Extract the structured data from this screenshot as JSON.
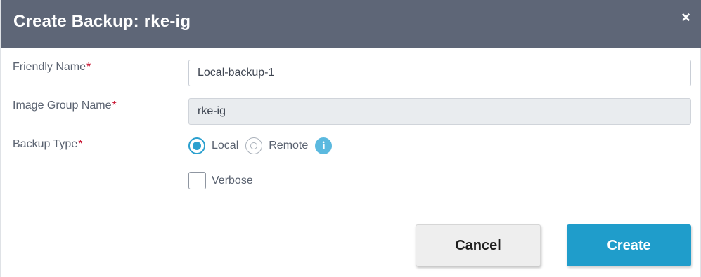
{
  "dialog": {
    "title": "Create Backup: rke-ig",
    "close_icon": "×"
  },
  "form": {
    "friendly_name": {
      "label": "Friendly Name",
      "required_mark": "*",
      "value": "Local-backup-1"
    },
    "image_group_name": {
      "label": "Image Group Name",
      "required_mark": "*",
      "value": "rke-ig"
    },
    "backup_type": {
      "label": "Backup Type",
      "required_mark": "*",
      "options": [
        {
          "label": "Local",
          "selected": true
        },
        {
          "label": "Remote",
          "selected": false
        }
      ],
      "info_icon": "i"
    },
    "verbose": {
      "label": "Verbose",
      "checked": false
    }
  },
  "footer": {
    "cancel_label": "Cancel",
    "create_label": "Create"
  },
  "colors": {
    "header_bg": "#5e6677",
    "accent": "#1f9dcb",
    "required": "#c8102e"
  },
  "icons": {
    "close": "close-icon",
    "info": "info-icon"
  }
}
